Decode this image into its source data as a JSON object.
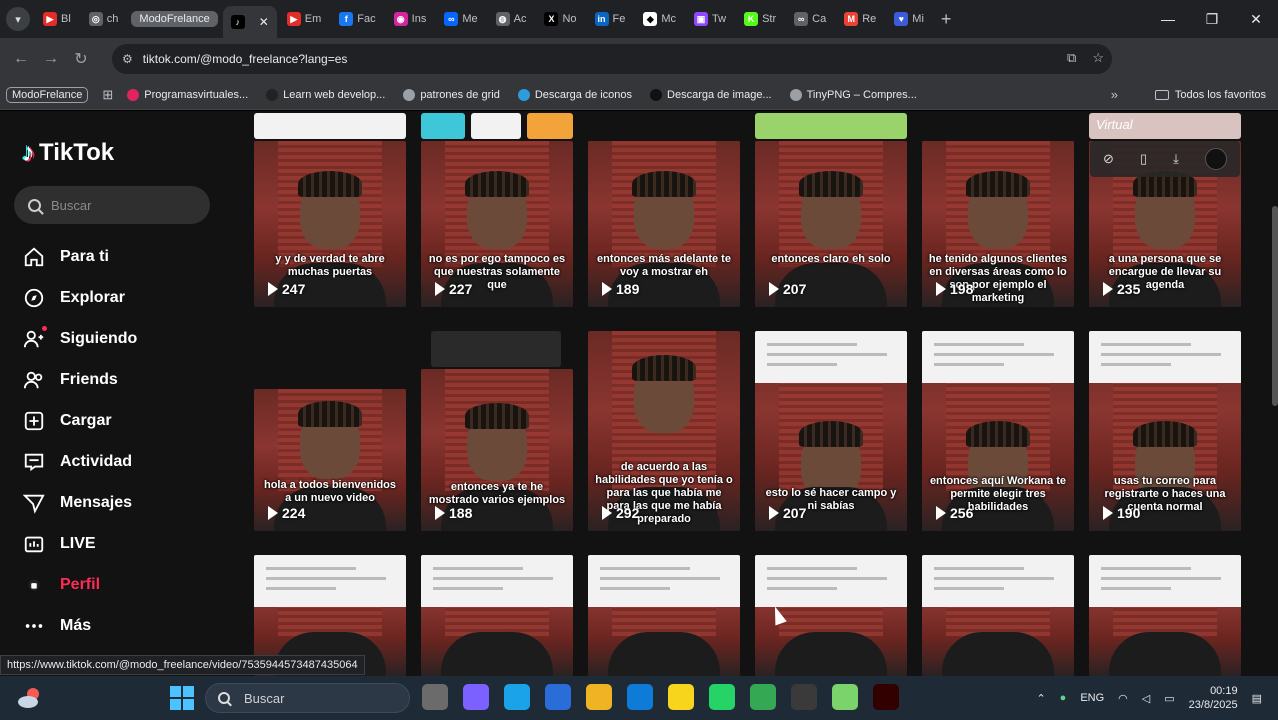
{
  "browser": {
    "tab_group": "ModoFrelance",
    "tabs": [
      {
        "label": "Bl",
        "color": "#e52d27",
        "glyph": "▶"
      },
      {
        "label": "ch",
        "color": "#5f6368",
        "glyph": "◎"
      },
      {
        "label": "",
        "color": "#000000",
        "glyph": "♪",
        "active": true
      },
      {
        "label": "Em",
        "color": "#e52d27",
        "glyph": "▶"
      },
      {
        "label": "Fac",
        "color": "#1877f2",
        "glyph": "f"
      },
      {
        "label": "Ins",
        "color": "#d6249f",
        "glyph": "◉"
      },
      {
        "label": "Me",
        "color": "#0866ff",
        "glyph": "∞"
      },
      {
        "label": "Ac",
        "color": "#5f6368",
        "glyph": "◍"
      },
      {
        "label": "No",
        "color": "#000000",
        "glyph": "X"
      },
      {
        "label": "Fe",
        "color": "#0a66c2",
        "glyph": "in"
      },
      {
        "label": "Mc",
        "color": "#ffffff",
        "glyph": "◆"
      },
      {
        "label": "Tw",
        "color": "#9146ff",
        "glyph": "▣"
      },
      {
        "label": "Str",
        "color": "#53fc18",
        "glyph": "K"
      },
      {
        "label": "Ca",
        "color": "#5f6368",
        "glyph": "∞"
      },
      {
        "label": "Re",
        "color": "#ea4335",
        "glyph": "M"
      },
      {
        "label": "Mi",
        "color": "#3b5bdb",
        "glyph": "♥"
      }
    ],
    "url": "tiktok.com/@modo_freelance?lang=es",
    "bookmarks_group": "ModoFrelance",
    "bookmarks": [
      {
        "label": "Programasvirtuales...",
        "color": "#e0245e"
      },
      {
        "label": "Learn web develop...",
        "color": "#222222"
      },
      {
        "label": "patrones de grid",
        "color": "#9aa0a6"
      },
      {
        "label": "Descarga de iconos",
        "color": "#2d9cdb"
      },
      {
        "label": "Descarga de image...",
        "color": "#111111"
      },
      {
        "label": "TinyPNG – Compres...",
        "color": "#9aa0a6"
      }
    ],
    "all_bookmarks": "Todos los favoritos",
    "status_url": "https://www.tiktok.com/@modo_freelance/video/7535944573487435064"
  },
  "tiktok": {
    "logo": "TikTok",
    "search_placeholder": "Buscar",
    "nav": [
      {
        "label": "Para ti",
        "icon": "home-icon"
      },
      {
        "label": "Explorar",
        "icon": "compass-icon"
      },
      {
        "label": "Siguiendo",
        "icon": "following-icon"
      },
      {
        "label": "Friends",
        "icon": "friends-icon"
      },
      {
        "label": "Cargar",
        "icon": "upload-icon"
      },
      {
        "label": "Actividad",
        "icon": "activity-icon"
      },
      {
        "label": "Mensajes",
        "icon": "messages-icon"
      },
      {
        "label": "LIVE",
        "icon": "live-icon"
      },
      {
        "label": "Perfil",
        "icon": "profile-icon"
      },
      {
        "label": "Más",
        "icon": "more-icon"
      }
    ],
    "hover_label": "Virtual",
    "videos_row1": [
      {
        "caption": "y y de verdad te abre muchas puertas",
        "views": "247"
      },
      {
        "caption": "no es por ego tampoco es que nuestras solamente que",
        "views": "227"
      },
      {
        "caption": "entonces más adelante te voy a mostrar eh",
        "views": "189"
      },
      {
        "caption": "entonces claro eh solo",
        "views": "207"
      },
      {
        "caption": "he tenido algunos clientes en diversas áreas como lo son por ejemplo el marketing",
        "views": "198"
      },
      {
        "caption": "a una persona que se encargue de llevar su agenda",
        "views": "235"
      }
    ],
    "videos_row2": [
      {
        "caption": "hola a todos bienvenidos a un nuevo video",
        "views": "224"
      },
      {
        "caption": "entonces ya te he mostrado varios ejemplos",
        "views": "188"
      },
      {
        "caption": "de acuerdo a las habilidades que yo tenía o para las que había me para las que me había preparado",
        "views": "292"
      },
      {
        "caption": "esto lo sé hacer campo y ni sabías",
        "views": "207"
      },
      {
        "caption": "entonces aquí Workana te permite elegir tres habilidades",
        "views": "256"
      },
      {
        "caption": "usas tu correo para registrarte o haces una cuenta normal",
        "views": "190"
      }
    ]
  },
  "taskbar": {
    "search_label": "Buscar",
    "lang": "ENG",
    "time": "00:19",
    "date": "23/8/2025",
    "apps": [
      "#6b6b6b",
      "#7b61ff",
      "#1aa3e8",
      "#2a6dd8",
      "#f0b323",
      "#0f7bd8",
      "#f7d51d",
      "#25d366",
      "#34a853",
      "#3a3a3a",
      "#7ad36b",
      "#330000"
    ]
  }
}
